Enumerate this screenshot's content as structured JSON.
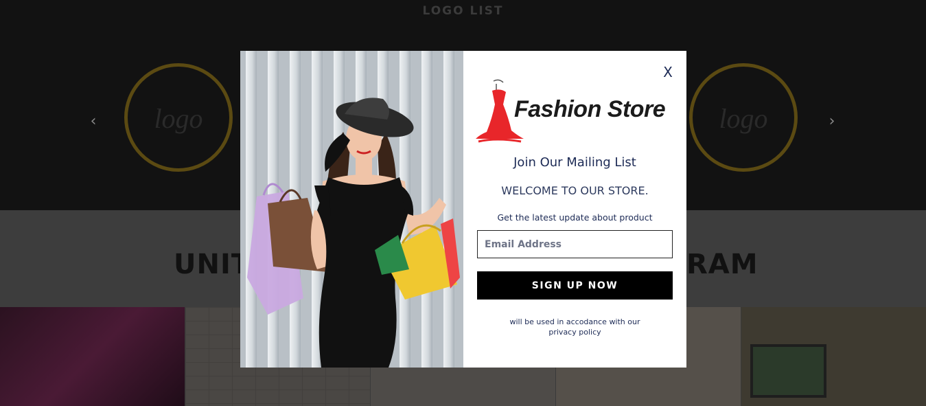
{
  "background": {
    "logo_section": {
      "title": "LOGO LIST",
      "logo_word": "logo",
      "prev_arrow": "‹",
      "next_arrow": "›"
    },
    "instagram_section": {
      "heading_left_fragment": "UNIT",
      "heading_right_fragment": "RAM"
    }
  },
  "modal": {
    "close_label": "X",
    "brand_name": "Fashion Store",
    "mailing_title": "Join Our Mailing List",
    "welcome_text": "WELCOME TO OUR STORE.",
    "latest_text": "Get the latest update about product",
    "email_placeholder": "Email Address",
    "signup_label": "SIGN UP NOW",
    "policy_line1": "will be used in accodance with our",
    "policy_line2": "privacy policy"
  },
  "colors": {
    "overlay_dark": "#121212",
    "modal_bg": "#ffffff",
    "text_navy": "#1c2a55",
    "button_bg": "#000000",
    "brand_red": "#e8262a",
    "logo_ring": "#5b4a12"
  },
  "icons": {
    "close": "close-icon",
    "prev": "chevron-left-icon",
    "next": "chevron-right-icon",
    "brand": "dress-logo-icon"
  }
}
